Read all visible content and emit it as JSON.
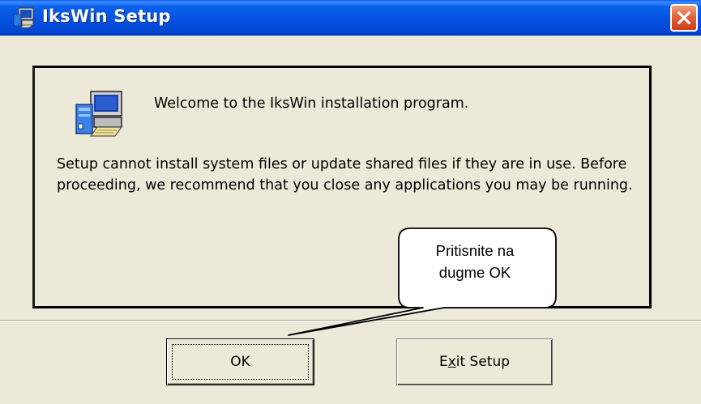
{
  "window": {
    "title": "IksWin Setup"
  },
  "icons": {
    "app": "setup-computer-icon",
    "close": "close-icon",
    "setup": "setup-computer-icon"
  },
  "content": {
    "welcome": "Welcome to the IksWin installation program.",
    "message": "Setup cannot install system files or update shared files if they are in use. Before proceeding, we recommend that you close any applications you may be running."
  },
  "buttons": {
    "ok": "OK",
    "exit_pre": "E",
    "exit_access": "x",
    "exit_post": "it Setup"
  },
  "callout": {
    "line1": "Pritisnite na",
    "line2": "dugme OK"
  },
  "colors": {
    "titlebar": "#0451e3",
    "dialog_bg": "#ece9d8",
    "close": "#e5633c"
  }
}
